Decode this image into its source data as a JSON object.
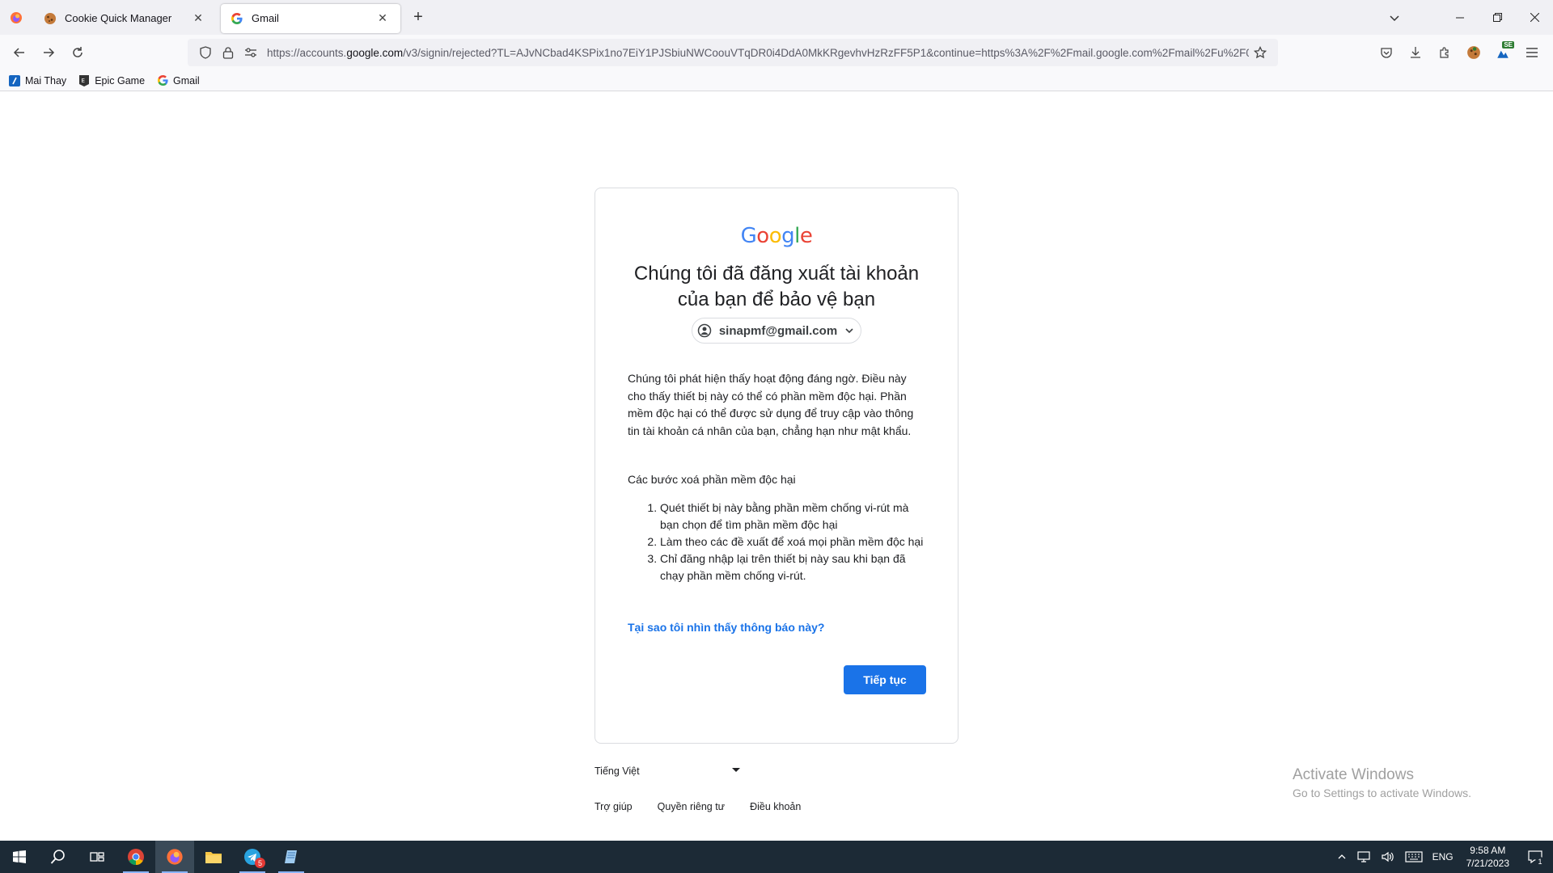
{
  "browser": {
    "tabs": [
      {
        "label": "Cookie Quick Manager",
        "icon": "cookie-icon"
      },
      {
        "label": "Gmail",
        "icon": "google-g-icon"
      }
    ],
    "url_prefix": "https://accounts.",
    "url_host": "google.com",
    "url_rest": "/v3/signin/rejected?TL=AJvNCbad4KSPix1no7EiY1PJSbiuNWCoouVTqDR0i4DdA0MkKRgevhvHzRzFF5P1&continue=https%3A%2F%2Fmail.google.com%2Fmail%2Fu%2F0%",
    "ext_badge": "SE"
  },
  "bookmarks": [
    {
      "label": "Mai Thay",
      "icon": "bookmark-blue-icon"
    },
    {
      "label": "Epic Game",
      "icon": "epic-games-icon"
    },
    {
      "label": "Gmail",
      "icon": "google-g-icon"
    }
  ],
  "page": {
    "logo": [
      "G",
      "o",
      "o",
      "g",
      "l",
      "e"
    ],
    "headline_line1": "Chúng tôi đã đăng xuất tài khoản",
    "headline_line2": "của bạn để bảo vệ bạn",
    "account_email": "sinapmf@gmail.com",
    "body": "Chúng tôi phát hiện thấy hoạt động đáng ngờ. Điều này cho thấy thiết bị này có thể có phần mềm độc hại. Phần mềm độc hại có thể được sử dụng để truy cập vào thông tin tài khoản cá nhân của bạn, chẳng hạn như mật khẩu.",
    "steps_title": "Các bước xoá phần mềm độc hại",
    "steps": [
      "Quét thiết bị này bằng phần mềm chống vi-rút mà bạn chọn để tìm phần mềm độc hại",
      "Làm theo các đề xuất để xoá mọi phần mềm độc hại",
      "Chỉ đăng nhập lại trên thiết bị này sau khi bạn đã chạy phần mềm chống vi-rút."
    ],
    "why_link": "Tại sao tôi nhìn thấy thông báo này?",
    "continue_label": "Tiếp tục",
    "language": "Tiếng Việt",
    "footer": [
      "Trợ giúp",
      "Quyền riêng tư",
      "Điều khoản"
    ]
  },
  "watermark": {
    "line1": "Activate Windows",
    "line2": "Go to Settings to activate Windows."
  },
  "taskbar": {
    "telegram_badge": "5",
    "lang": "ENG",
    "time": "9:58 AM",
    "date": "7/21/2023",
    "notif_count": "1"
  },
  "colors": {
    "google_blue": "#4285F4",
    "google_red": "#EA4335",
    "google_yellow": "#FBBC05",
    "google_green": "#34A853",
    "button_blue": "#1a73e8"
  }
}
